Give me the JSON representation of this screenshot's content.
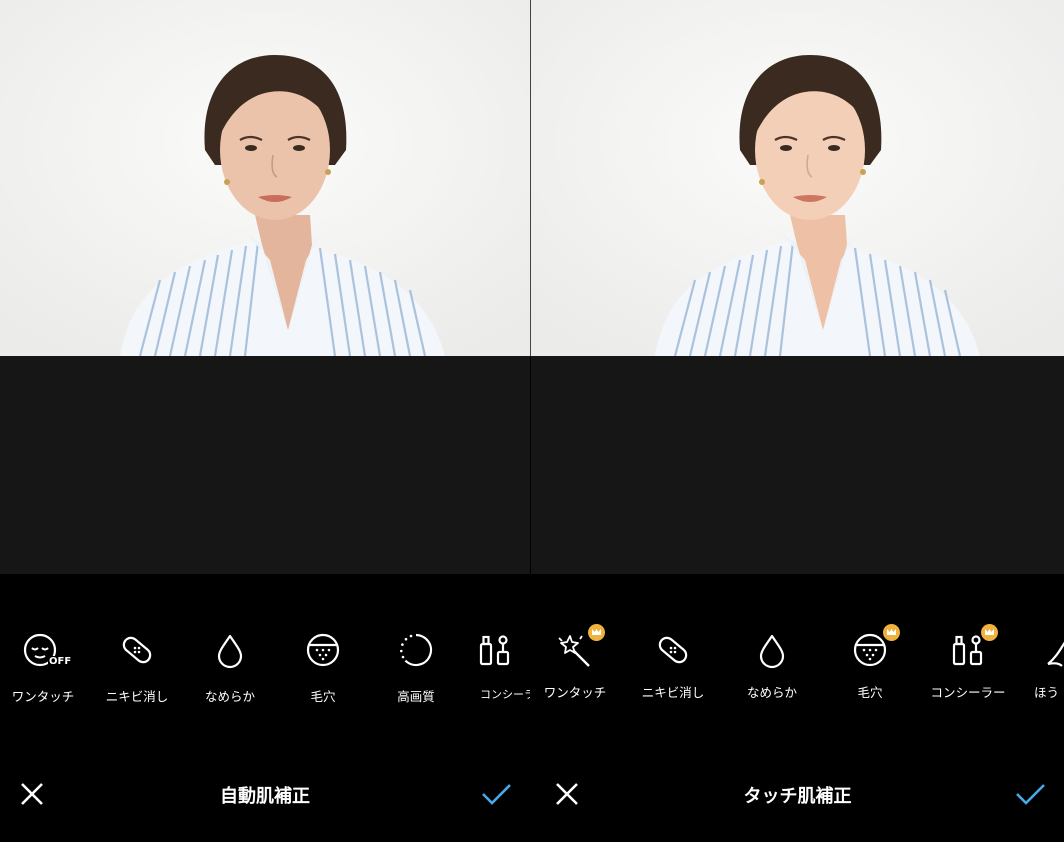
{
  "left_panel": {
    "title": "自動肌補正",
    "tools": [
      {
        "label": "ワンタッチ",
        "icon": "face-off-icon",
        "off_badge": "OFF"
      },
      {
        "label": "ニキビ消し",
        "icon": "bandage-icon"
      },
      {
        "label": "なめらか",
        "icon": "drop-icon"
      },
      {
        "label": "毛穴",
        "icon": "pores-icon"
      },
      {
        "label": "高画質",
        "icon": "dotted-circle-icon"
      },
      {
        "label": "コンシーラ",
        "icon": "concealer-icon"
      }
    ]
  },
  "right_panel": {
    "title": "タッチ肌補正",
    "tools": [
      {
        "label": "ワンタッチ",
        "icon": "magic-wand-icon",
        "premium": true
      },
      {
        "label": "ニキビ消し",
        "icon": "bandage-icon"
      },
      {
        "label": "なめらか",
        "icon": "drop-icon"
      },
      {
        "label": "毛穴",
        "icon": "pores-icon",
        "premium": true
      },
      {
        "label": "コンシーラー",
        "icon": "concealer-icon",
        "premium": true
      },
      {
        "label": "ほう",
        "icon": "nasolabial-icon"
      }
    ]
  },
  "colors": {
    "accent": "#4aa8e8",
    "premium_badge": "#f0b23c",
    "canvas": "#161616",
    "toolbar": "#000000"
  }
}
